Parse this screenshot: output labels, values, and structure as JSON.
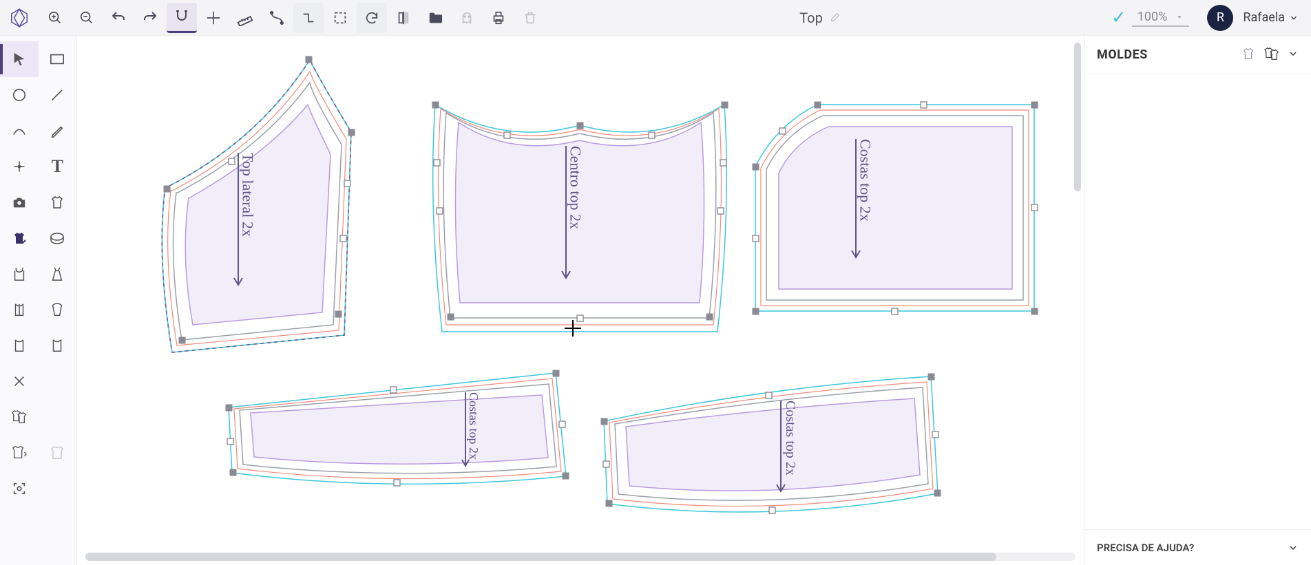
{
  "document": {
    "title": "Top"
  },
  "zoom": {
    "value": "100%"
  },
  "user": {
    "initial": "R",
    "name": "Rafaela"
  },
  "right_panel": {
    "title": "MOLDES",
    "help_label": "PRECISA DE AJUDA?"
  },
  "pieces": {
    "p1_label": "Top lateral 2x",
    "p2_label": "Centro top 2x",
    "p3_label": "Costas top 2x",
    "p4_label": "Costas top 2x",
    "p5_label": "Costas top 2x"
  }
}
